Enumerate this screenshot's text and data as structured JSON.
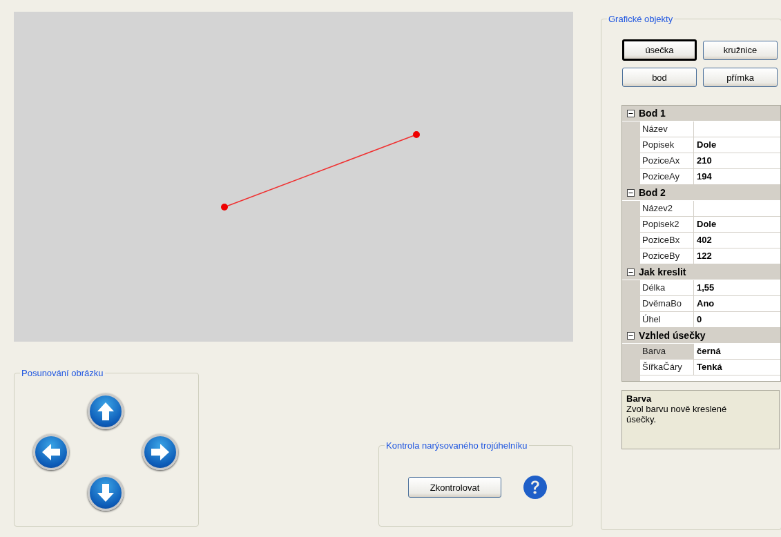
{
  "shift_panel": {
    "title": "Posunování obrázku"
  },
  "check_panel": {
    "title": "Kontrola narýsovaného trojúhelníku",
    "button": "Zkontrolovat"
  },
  "objects_panel": {
    "title": "Grafické objekty",
    "buttons": [
      {
        "label": "úsečka",
        "selected": true
      },
      {
        "label": "kružnice",
        "selected": false
      },
      {
        "label": "bod",
        "selected": false
      },
      {
        "label": "přímka",
        "selected": false
      }
    ],
    "property_grid": {
      "categories": [
        {
          "name": "Bod 1",
          "expanded": true,
          "properties": [
            {
              "name": "Název",
              "selected": false
            },
            {
              "name": "Popisek",
              "value": "Dole",
              "selected": false
            },
            {
              "name": "PoziceAx",
              "value": "210",
              "selected": false
            },
            {
              "name": "PoziceAy",
              "value": "194",
              "selected": false
            }
          ]
        },
        {
          "name": "Bod 2",
          "expanded": true,
          "properties": [
            {
              "name": "Název2",
              "selected": false
            },
            {
              "name": "Popisek2",
              "value": "Dole",
              "selected": false
            },
            {
              "name": "PoziceBx",
              "value": "402",
              "selected": false
            },
            {
              "name": "PoziceBy",
              "value": "122",
              "selected": false
            }
          ]
        },
        {
          "name": "Jak kreslit",
          "expanded": true,
          "properties": [
            {
              "name": "Délka",
              "value": "1,55",
              "selected": false
            },
            {
              "name": "DvěmaBo",
              "value": "Ano",
              "selected": false
            },
            {
              "name": "Úhel",
              "value": "0",
              "selected": false
            }
          ]
        },
        {
          "name": "Vzhled úsečky",
          "expanded": true,
          "properties": [
            {
              "name": "Barva",
              "value": "černá",
              "selected": true
            },
            {
              "name": "ŠířkaČáry",
              "value": "Tenká",
              "selected": false
            }
          ]
        }
      ]
    },
    "help": {
      "title": "Barva",
      "text": "Zvol barvu nově kreslené úsečky."
    }
  }
}
